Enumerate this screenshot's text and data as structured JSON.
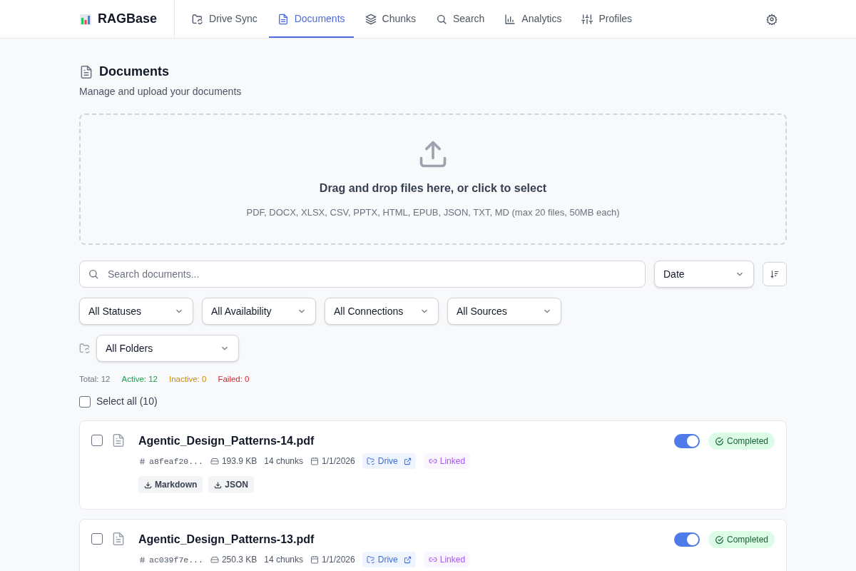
{
  "app": {
    "name": "RAGBase"
  },
  "nav": [
    {
      "label": "Drive Sync",
      "selected": false
    },
    {
      "label": "Documents",
      "selected": true
    },
    {
      "label": "Chunks",
      "selected": false
    },
    {
      "label": "Search",
      "selected": false
    },
    {
      "label": "Analytics",
      "selected": false
    },
    {
      "label": "Profiles",
      "selected": false
    }
  ],
  "page": {
    "title": "Documents",
    "subtitle": "Manage and upload your documents"
  },
  "upload": {
    "title": "Drag and drop files here, or click to select",
    "hint": "PDF, DOCX, XLSX, CSV, PPTX, HTML, EPUB, JSON, TXT, MD (max 20 files, 50MB each)"
  },
  "search": {
    "placeholder": "Search documents..."
  },
  "sort": {
    "value": "Date"
  },
  "filters": [
    "All Statuses",
    "All Availability",
    "All Connections",
    "All Sources"
  ],
  "folder_filter": "All Folders",
  "stats": [
    {
      "text": "Total: 12",
      "color": "#6b7280"
    },
    {
      "text": "Active: 12",
      "color": "#16a34a"
    },
    {
      "text": "Inactive: 0",
      "color": "#ca8a04"
    },
    {
      "text": "Failed: 0",
      "color": "#dc2626"
    }
  ],
  "select_all": {
    "label": "Select all (10)",
    "checked": false
  },
  "documents": [
    {
      "name": "Agentic_Design_Patterns-14.pdf",
      "checked": false,
      "hash": "a8feaf20...",
      "size": "193.9 KB",
      "chunks": "14 chunks",
      "date": "1/1/2026",
      "source": "Drive",
      "link": "Linked",
      "on": true,
      "status": "Completed",
      "downloads": [
        "Markdown",
        "JSON"
      ]
    },
    {
      "name": "Agentic_Design_Patterns-13.pdf",
      "checked": false,
      "hash": "ac039f7e...",
      "size": "250.3 KB",
      "chunks": "14 chunks",
      "date": "1/1/2026",
      "source": "Drive",
      "link": "Linked",
      "on": true,
      "status": "Completed"
    }
  ]
}
